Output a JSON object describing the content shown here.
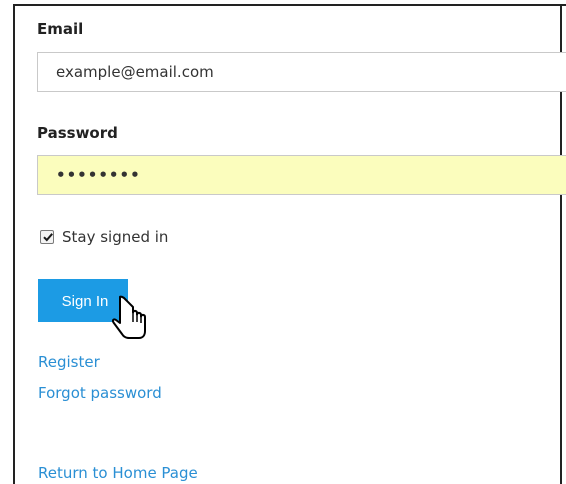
{
  "form": {
    "email_label": "Email",
    "email_value": "example@email.com",
    "password_label": "Password",
    "password_value": "••••••••",
    "stay_signed_in_label": "Stay signed in",
    "stay_signed_in_checked": true,
    "signin_label": "Sign In"
  },
  "links": {
    "register": "Register",
    "forgot_password": "Forgot password",
    "return_home": "Return to Home Page"
  },
  "colors": {
    "primary_button": "#1c9be4",
    "link": "#2a8fd4",
    "password_autofill_bg": "#fbfdbd"
  },
  "icons": {
    "cursor": "hand-pointer-cursor-icon",
    "checkbox": "checkmark-icon"
  }
}
